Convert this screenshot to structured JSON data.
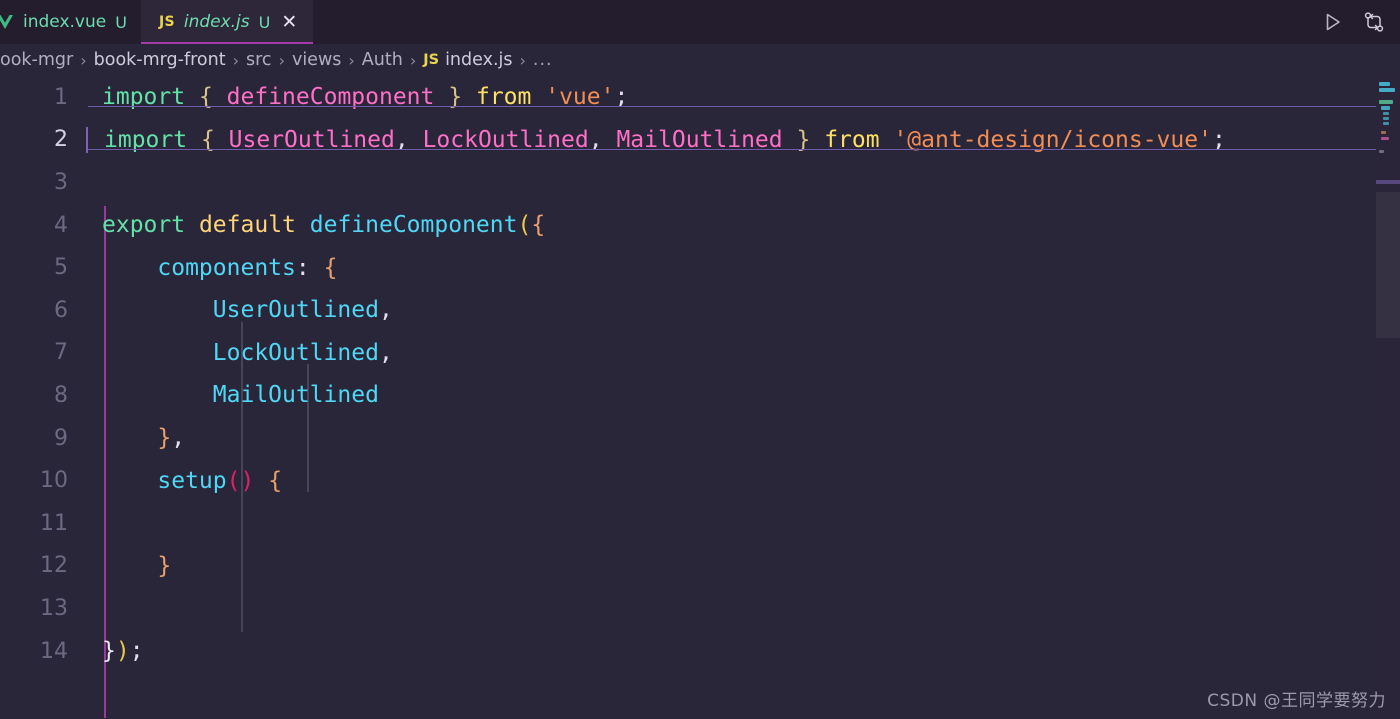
{
  "window": {
    "background_color": "#292639",
    "tabbar_color": "#241d2d",
    "accent_color": "#a43ca8"
  },
  "tabs": [
    {
      "name": "index.vue",
      "icon": "vue-icon",
      "badge": "U",
      "active": false,
      "has_close": false
    },
    {
      "name": "index.js",
      "icon": "js-icon",
      "icon_label": "JS",
      "badge": "U",
      "active": true,
      "has_close": true,
      "close_label": "✕"
    }
  ],
  "tab_actions": [
    {
      "name": "run-button",
      "icon": "play-icon"
    },
    {
      "name": "compare-button",
      "icon": "swap-arrows-icon"
    }
  ],
  "breadcrumb": {
    "separator": "›",
    "items": [
      {
        "label": "ook-mgr",
        "type": "folder"
      },
      {
        "label": "book-mrg-front",
        "type": "folder"
      },
      {
        "label": "src",
        "type": "folder"
      },
      {
        "label": "views",
        "type": "folder"
      },
      {
        "label": "Auth",
        "type": "folder"
      },
      {
        "label": "index.js",
        "type": "file",
        "icon_label": "JS"
      }
    ],
    "overflow": "..."
  },
  "editor": {
    "active_line": 2,
    "total_lines": 14,
    "lines": [
      {
        "number": "1",
        "tokens": [
          {
            "text": "import",
            "cls": "t-kw"
          },
          {
            "text": " ",
            "cls": "t-punc"
          },
          {
            "text": "{",
            "cls": "t-brace"
          },
          {
            "text": " ",
            "cls": "t-punc"
          },
          {
            "text": "defineComponent",
            "cls": "t-ident"
          },
          {
            "text": " ",
            "cls": "t-punc"
          },
          {
            "text": "}",
            "cls": "t-brace"
          },
          {
            "text": " ",
            "cls": "t-punc"
          },
          {
            "text": "from",
            "cls": "t-from"
          },
          {
            "text": " ",
            "cls": "t-punc"
          },
          {
            "text": "'vue'",
            "cls": "t-str"
          },
          {
            "text": ";",
            "cls": "t-punc"
          }
        ]
      },
      {
        "number": "2",
        "tokens": [
          {
            "text": "import",
            "cls": "t-kw"
          },
          {
            "text": " ",
            "cls": "t-punc"
          },
          {
            "text": "{",
            "cls": "t-brace"
          },
          {
            "text": " ",
            "cls": "t-punc"
          },
          {
            "text": "UserOutlined",
            "cls": "t-ident"
          },
          {
            "text": ",",
            "cls": "t-punc"
          },
          {
            "text": " ",
            "cls": "t-punc"
          },
          {
            "text": "LockOutlined",
            "cls": "t-ident"
          },
          {
            "text": ",",
            "cls": "t-punc"
          },
          {
            "text": " ",
            "cls": "t-punc"
          },
          {
            "text": "MailOutlined",
            "cls": "t-ident"
          },
          {
            "text": " ",
            "cls": "t-punc"
          },
          {
            "text": "}",
            "cls": "t-brace"
          },
          {
            "text": " ",
            "cls": "t-punc"
          },
          {
            "text": "from",
            "cls": "t-from"
          },
          {
            "text": " ",
            "cls": "t-punc"
          },
          {
            "text": "'@ant-design/icons-vue'",
            "cls": "t-str"
          },
          {
            "text": ";",
            "cls": "t-punc"
          }
        ]
      },
      {
        "number": "3",
        "tokens": []
      },
      {
        "number": "4",
        "tokens": [
          {
            "text": "export",
            "cls": "t-kw"
          },
          {
            "text": " ",
            "cls": "t-punc"
          },
          {
            "text": "default",
            "cls": "t-kw2"
          },
          {
            "text": " ",
            "cls": "t-punc"
          },
          {
            "text": "defineComponent",
            "cls": "t-fn"
          },
          {
            "text": "(",
            "cls": "t-brace-y"
          },
          {
            "text": "{",
            "cls": "t-brace-o"
          }
        ]
      },
      {
        "number": "5",
        "tokens": [
          {
            "text": "    ",
            "cls": "t-punc"
          },
          {
            "text": "components",
            "cls": "t-prop"
          },
          {
            "text": ":",
            "cls": "t-punc"
          },
          {
            "text": " ",
            "cls": "t-punc"
          },
          {
            "text": "{",
            "cls": "t-brace-o"
          }
        ]
      },
      {
        "number": "6",
        "tokens": [
          {
            "text": "        ",
            "cls": "t-punc"
          },
          {
            "text": "UserOutlined",
            "cls": "t-fn"
          },
          {
            "text": ",",
            "cls": "t-punc"
          }
        ]
      },
      {
        "number": "7",
        "tokens": [
          {
            "text": "        ",
            "cls": "t-punc"
          },
          {
            "text": "LockOutlined",
            "cls": "t-fn"
          },
          {
            "text": ",",
            "cls": "t-punc"
          }
        ]
      },
      {
        "number": "8",
        "tokens": [
          {
            "text": "        ",
            "cls": "t-punc"
          },
          {
            "text": "MailOutlined",
            "cls": "t-fn"
          }
        ]
      },
      {
        "number": "9",
        "tokens": [
          {
            "text": "    ",
            "cls": "t-punc"
          },
          {
            "text": "}",
            "cls": "t-brace-o"
          },
          {
            "text": ",",
            "cls": "t-punc"
          }
        ]
      },
      {
        "number": "10",
        "tokens": [
          {
            "text": "    ",
            "cls": "t-punc"
          },
          {
            "text": "setup",
            "cls": "t-fn"
          },
          {
            "text": "()",
            "cls": "t-paren"
          },
          {
            "text": " ",
            "cls": "t-punc"
          },
          {
            "text": "{",
            "cls": "t-brace-o"
          }
        ]
      },
      {
        "number": "11",
        "tokens": []
      },
      {
        "number": "12",
        "tokens": [
          {
            "text": "    ",
            "cls": "t-punc"
          },
          {
            "text": "}",
            "cls": "t-brace-o"
          }
        ]
      },
      {
        "number": "13",
        "tokens": []
      },
      {
        "number": "14",
        "tokens": [
          {
            "text": "}",
            "cls": "t-brace-w"
          },
          {
            "text": ")",
            "cls": "t-brace-y"
          },
          {
            "text": ";",
            "cls": "t-punc"
          }
        ]
      }
    ]
  },
  "watermark": {
    "text": "CSDN @王同学要努力"
  }
}
